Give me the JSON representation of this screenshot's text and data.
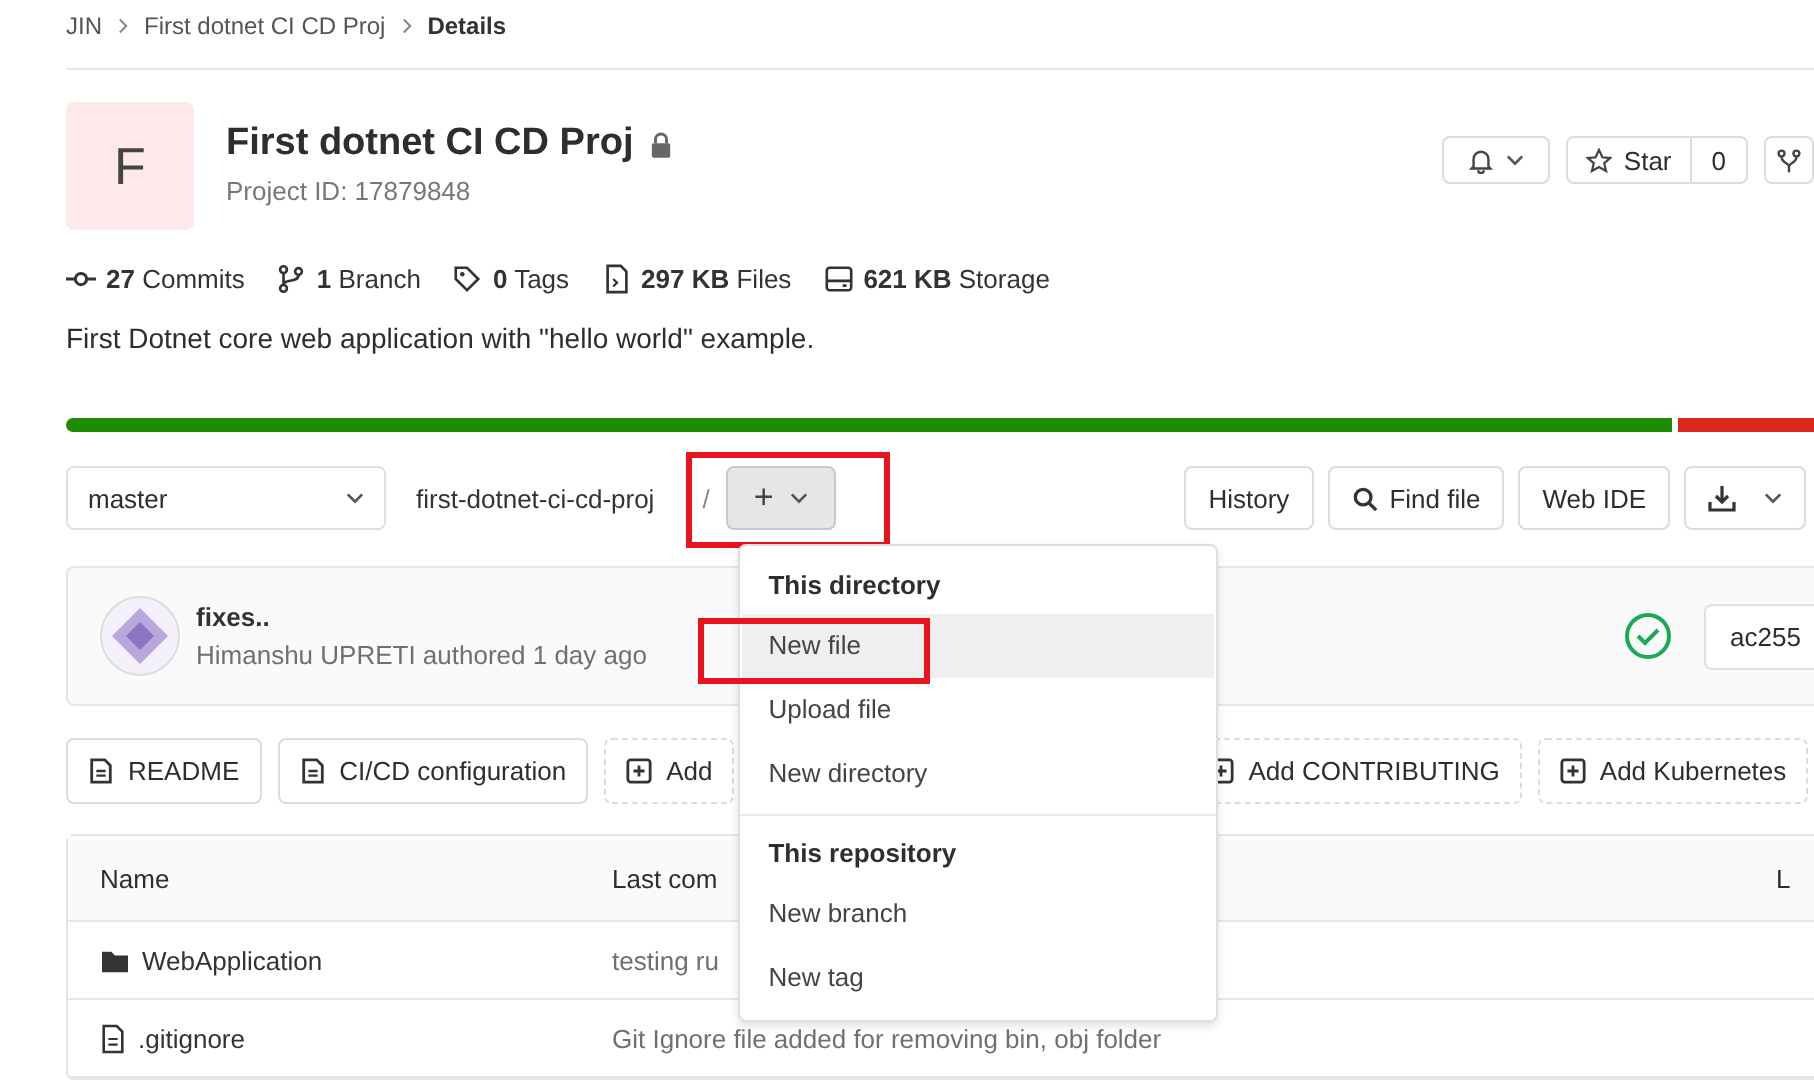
{
  "breadcrumbs": [
    {
      "label": "JIN",
      "current": false
    },
    {
      "label": "First dotnet CI CD Proj",
      "current": false
    },
    {
      "label": "Details",
      "current": true
    }
  ],
  "project": {
    "avatar_letter": "F",
    "name": "First dotnet CI CD Proj",
    "private": true,
    "id_text": "Project ID: 17879848"
  },
  "header_actions": {
    "star_label": "Star",
    "star_count": "0"
  },
  "stats": [
    {
      "kind": "commits",
      "value": "27",
      "label": "Commits"
    },
    {
      "kind": "branch",
      "value": "1",
      "label": "Branch"
    },
    {
      "kind": "tags",
      "value": "0",
      "label": "Tags"
    },
    {
      "kind": "files",
      "value": "297 KB",
      "label": "Files"
    },
    {
      "kind": "storage",
      "value": "621 KB",
      "label": "Storage"
    }
  ],
  "description": "First Dotnet core web application with \"hello world\" example.",
  "ref_bar": {
    "branch": "master",
    "path": "first-dotnet-ci-cd-proj",
    "separator": "/",
    "add_button": {
      "label": "+",
      "highlighted": true
    }
  },
  "tree_actions": [
    {
      "kind": "text",
      "label": "History"
    },
    {
      "kind": "search",
      "label": "Find file"
    },
    {
      "kind": "text",
      "label": "Web IDE"
    },
    {
      "kind": "download"
    }
  ],
  "dropdown": {
    "sections": [
      {
        "title": "This directory",
        "items": [
          {
            "label": "New file",
            "selected": true,
            "highlighted": true
          },
          {
            "label": "Upload file",
            "selected": false,
            "highlighted": false
          },
          {
            "label": "New directory",
            "selected": false,
            "highlighted": false
          }
        ]
      },
      {
        "title": "This repository",
        "items": [
          {
            "label": "New branch",
            "selected": false,
            "highlighted": false
          },
          {
            "label": "New tag",
            "selected": false,
            "highlighted": false
          }
        ]
      }
    ]
  },
  "commit": {
    "title": "fixes..",
    "meta": "Himanshu UPRETI authored 1 day ago",
    "pipeline_passed": true,
    "sha": "ac255"
  },
  "shortcuts": [
    {
      "kind": "existing",
      "label": "README"
    },
    {
      "kind": "existing",
      "label": "CI/CD configuration"
    },
    {
      "kind": "add",
      "label": "Add"
    },
    {
      "kind": "add",
      "label": "Add CONTRIBUTING"
    },
    {
      "kind": "add",
      "label": "Add Kubernetes"
    }
  ],
  "table": {
    "columns": [
      "Name",
      "Last com",
      "L"
    ],
    "rows": [
      {
        "kind": "folder",
        "name": "WebApplication",
        "message": "testing ru"
      },
      {
        "kind": "file",
        "name": ".gitignore",
        "message": "Git Ignore file added for removing bin, obj folder"
      }
    ]
  }
}
